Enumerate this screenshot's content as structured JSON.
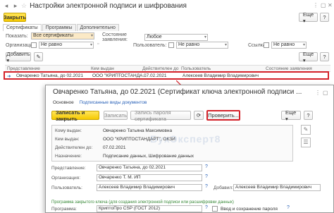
{
  "window": {
    "title": "Настройки электронной подписи и шифрования",
    "more": "Еще ▾",
    "help": "?"
  },
  "toolbar": {
    "close_label": "Закрыть"
  },
  "tabs": [
    {
      "label": "Сертификаты"
    },
    {
      "label": "Программы"
    },
    {
      "label": "Дополнительно"
    }
  ],
  "filters": {
    "show_label": "Показать:",
    "show_value": "Все сертификаты",
    "state_label": "Состояние заявления:",
    "state_value": "Любое",
    "org_label": "Организация:",
    "org_value": "Не равно",
    "user_label": "Пользователь:",
    "user_value": "Не равно",
    "ref_label": "Ссылка:",
    "ref_value": "Не равно"
  },
  "list_toolbar": {
    "add_label": "Добавить ▾",
    "more": "Еще ▾",
    "help": "?"
  },
  "grid": {
    "columns": [
      "Представление",
      "Кем выдан",
      "Действителен до",
      "Пользователь",
      "Состояние заявления"
    ],
    "row": {
      "rep": "Овчаренко Татьяна, до 02.2021",
      "issuer": "ООО \"КРИПТОСТАНДА...",
      "valid": "07.02.2021",
      "user": "Алексеев Владимир Владимирович"
    }
  },
  "dialog": {
    "title": "Овчаренко Татьяна, до 02.2021 (Сертификат ключа электронной подписи ...",
    "link_main": "Основное",
    "link_docs": "Подписанные виды документов",
    "save_close": "Записать и закрыть",
    "save": "Записать",
    "request_pwd": "Запись пароля сертификата",
    "check": "Проверить...",
    "more": "Еще ▾",
    "help": "?",
    "info": {
      "to_label": "Кому выдан:",
      "to_value": "Овчаренко Татьяна Максимовна",
      "by_label": "Кем выдан:",
      "by_value": "ООО \"КРИПТОСТАНДАРТ\", ОКЗИ",
      "valid_label": "Действителен до:",
      "valid_value": "07.02.2021",
      "purpose_label": "Назначение:",
      "purpose_value": "Подписание данных, Шифрование данных"
    },
    "rep_label": "Представление:",
    "rep_value": "Овчаренко Татьяна, до 02.2021",
    "org_label": "Организация:",
    "org_value": "Овчаренко Т. М. ИП",
    "user_label": "Пользователь:",
    "user_value": "Алексеев Владимир Владимирович",
    "added_label": "Добавил:",
    "added_value": "Алексеев Владимир Владимирович",
    "note": "Программа закрытого ключа (для создания электронной подписи или расшифровки данных)",
    "program_label": "Программа:",
    "program_value": "КриптоПро CSP (ГОСТ 2012)",
    "remember_label": "Ввод и сохранение пароля",
    "watermark": "БухЭксперт8"
  }
}
